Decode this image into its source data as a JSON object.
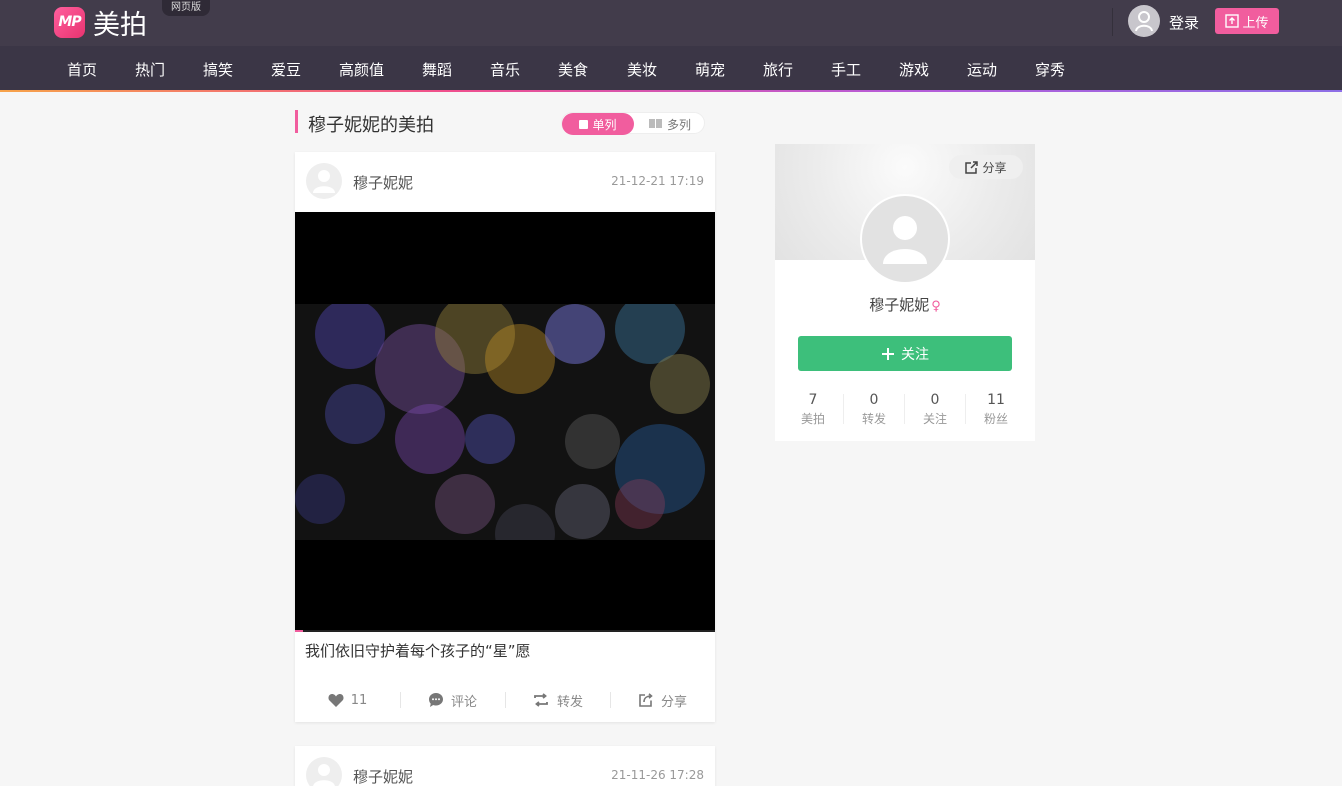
{
  "header": {
    "logo_mark": "MP",
    "logo_text": "美拍",
    "web_badge": "网页版",
    "login_label": "登录",
    "upload_label": "上传"
  },
  "nav": {
    "items": [
      "首页",
      "热门",
      "搞笑",
      "爱豆",
      "高颜值",
      "舞蹈",
      "音乐",
      "美食",
      "美妆",
      "萌宠",
      "旅行",
      "手工",
      "游戏",
      "运动",
      "穿秀"
    ]
  },
  "page": {
    "title": "穆子妮妮的美拍",
    "view_single": "单列",
    "view_multi": "多列"
  },
  "feed": [
    {
      "author": "穆子妮妮",
      "time": "21-12-21 17:19",
      "caption": "我们依旧守护着每个孩子的“星”愿",
      "likes": "11",
      "comment_label": "评论",
      "repost_label": "转发",
      "share_label": "分享"
    },
    {
      "author": "穆子妮妮",
      "time": "21-11-26 17:28"
    }
  ],
  "profile": {
    "share_label": "分享",
    "name": "穆子妮妮",
    "gender_symbol": "♀",
    "follow_label": "关注",
    "stats": [
      {
        "value": "7",
        "label": "美拍"
      },
      {
        "value": "0",
        "label": "转发"
      },
      {
        "value": "0",
        "label": "关注"
      },
      {
        "value": "11",
        "label": "粉丝"
      }
    ]
  },
  "colors": {
    "header_bg": "#423c4b",
    "nav_bg": "#3b3646",
    "accent_pink": "#f15d9e",
    "follow_green": "#3dbf7b"
  }
}
